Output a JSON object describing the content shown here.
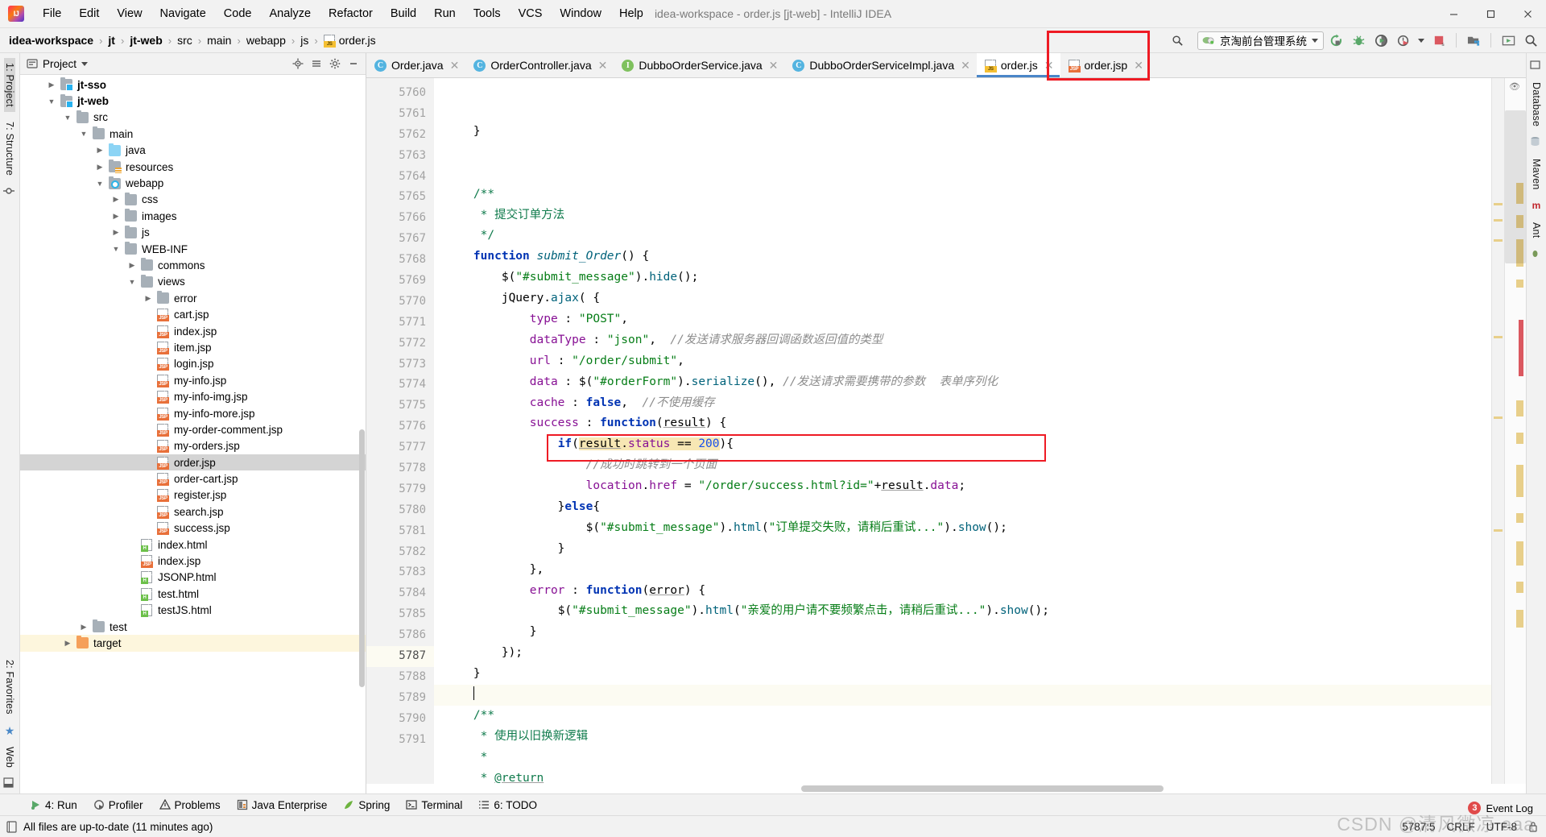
{
  "window": {
    "title": "idea-workspace - order.js [jt-web] - IntelliJ IDEA",
    "logo_name": "intellij-idea-logo",
    "minimize_label": "─",
    "maximize_label": "☐",
    "close_label": "✕"
  },
  "menubar": {
    "items": [
      {
        "label": "File"
      },
      {
        "label": "Edit"
      },
      {
        "label": "View"
      },
      {
        "label": "Navigate"
      },
      {
        "label": "Code"
      },
      {
        "label": "Analyze"
      },
      {
        "label": "Refactor"
      },
      {
        "label": "Build"
      },
      {
        "label": "Run"
      },
      {
        "label": "Tools"
      },
      {
        "label": "VCS"
      },
      {
        "label": "Window"
      },
      {
        "label": "Help"
      }
    ]
  },
  "navbar": {
    "breadcrumbs": [
      {
        "label": "idea-workspace",
        "bold": true
      },
      {
        "label": "jt",
        "bold": true
      },
      {
        "label": "jt-web",
        "bold": true
      },
      {
        "label": "src",
        "bold": false
      },
      {
        "label": "main",
        "bold": false
      },
      {
        "label": "webapp",
        "bold": false
      },
      {
        "label": "js",
        "bold": false
      },
      {
        "label": "order.js",
        "bold": false,
        "icon": "js-file-icon"
      }
    ],
    "separator": "›",
    "run_config": "京淘前台管理系统",
    "run_config_icon": "tomcat-icon",
    "actions": [
      {
        "name": "rerun-icon",
        "title": "Rerun"
      },
      {
        "name": "debug-icon",
        "title": "Debug"
      },
      {
        "name": "run-with-coverage-icon",
        "title": "Run with Coverage"
      },
      {
        "name": "profiler-icon",
        "title": "Profiler"
      },
      {
        "name": "stop-icon",
        "title": "Stop"
      },
      {
        "name": "project-structure-icon",
        "title": "Project Structure"
      },
      {
        "name": "updates-icon",
        "title": "Updates"
      },
      {
        "name": "search-everywhere-icon",
        "title": "Search Everywhere"
      }
    ]
  },
  "left_strip": {
    "items": [
      {
        "label": "1: Project",
        "name": "sidebar-item-project",
        "selected": true
      },
      {
        "label": "7: Structure",
        "name": "sidebar-item-structure",
        "selected": false
      }
    ],
    "bottom_items": [
      {
        "label": "2: Favorites",
        "name": "sidebar-item-favorites"
      },
      {
        "label": "Web",
        "name": "sidebar-item-web"
      }
    ]
  },
  "right_strip": {
    "items": [
      {
        "label": "Database",
        "name": "sidebar-item-database"
      },
      {
        "label": "Maven",
        "name": "sidebar-item-maven"
      },
      {
        "label": "Ant",
        "name": "sidebar-item-ant"
      }
    ]
  },
  "project_panel": {
    "title": "Project",
    "dropdown_caret": "▾",
    "actions": [
      {
        "name": "locate-icon",
        "title": "Select Opened File"
      },
      {
        "name": "collapse-all-icon",
        "title": "Collapse All"
      },
      {
        "name": "settings-gear-icon",
        "title": "Settings"
      },
      {
        "name": "hide-icon",
        "title": "Hide"
      }
    ],
    "tree": [
      {
        "indent": 1,
        "arrow": "right",
        "icon": "module",
        "label": "jt-sso",
        "bold": true
      },
      {
        "indent": 1,
        "arrow": "down",
        "icon": "module",
        "label": "jt-web",
        "bold": true
      },
      {
        "indent": 2,
        "arrow": "down",
        "icon": "folder",
        "label": "src",
        "bold": false
      },
      {
        "indent": 3,
        "arrow": "down",
        "icon": "folder",
        "label": "main",
        "bold": false
      },
      {
        "indent": 4,
        "arrow": "right",
        "icon": "folder-blue",
        "label": "java",
        "bold": false
      },
      {
        "indent": 4,
        "arrow": "right",
        "icon": "folder-res",
        "label": "resources",
        "bold": false
      },
      {
        "indent": 4,
        "arrow": "down",
        "icon": "folder-webapp",
        "label": "webapp",
        "bold": false
      },
      {
        "indent": 5,
        "arrow": "right",
        "icon": "folder",
        "label": "css",
        "bold": false
      },
      {
        "indent": 5,
        "arrow": "right",
        "icon": "folder",
        "label": "images",
        "bold": false
      },
      {
        "indent": 5,
        "arrow": "right",
        "icon": "folder",
        "label": "js",
        "bold": false
      },
      {
        "indent": 5,
        "arrow": "down",
        "icon": "folder",
        "label": "WEB-INF",
        "bold": false
      },
      {
        "indent": 6,
        "arrow": "right",
        "icon": "folder",
        "label": "commons",
        "bold": false
      },
      {
        "indent": 6,
        "arrow": "down",
        "icon": "folder",
        "label": "views",
        "bold": false
      },
      {
        "indent": 7,
        "arrow": "right",
        "icon": "folder",
        "label": "error",
        "bold": false
      },
      {
        "indent": 7,
        "arrow": "none",
        "icon": "jsp",
        "label": "cart.jsp",
        "bold": false
      },
      {
        "indent": 7,
        "arrow": "none",
        "icon": "jsp",
        "label": "index.jsp",
        "bold": false
      },
      {
        "indent": 7,
        "arrow": "none",
        "icon": "jsp",
        "label": "item.jsp",
        "bold": false
      },
      {
        "indent": 7,
        "arrow": "none",
        "icon": "jsp",
        "label": "login.jsp",
        "bold": false
      },
      {
        "indent": 7,
        "arrow": "none",
        "icon": "jsp",
        "label": "my-info.jsp",
        "bold": false
      },
      {
        "indent": 7,
        "arrow": "none",
        "icon": "jsp",
        "label": "my-info-img.jsp",
        "bold": false
      },
      {
        "indent": 7,
        "arrow": "none",
        "icon": "jsp",
        "label": "my-info-more.jsp",
        "bold": false
      },
      {
        "indent": 7,
        "arrow": "none",
        "icon": "jsp",
        "label": "my-order-comment.jsp",
        "bold": false
      },
      {
        "indent": 7,
        "arrow": "none",
        "icon": "jsp",
        "label": "my-orders.jsp",
        "bold": false
      },
      {
        "indent": 7,
        "arrow": "none",
        "icon": "jsp",
        "label": "order.jsp",
        "bold": false,
        "selected": true
      },
      {
        "indent": 7,
        "arrow": "none",
        "icon": "jsp",
        "label": "order-cart.jsp",
        "bold": false
      },
      {
        "indent": 7,
        "arrow": "none",
        "icon": "jsp",
        "label": "register.jsp",
        "bold": false
      },
      {
        "indent": 7,
        "arrow": "none",
        "icon": "jsp",
        "label": "search.jsp",
        "bold": false
      },
      {
        "indent": 7,
        "arrow": "none",
        "icon": "jsp",
        "label": "success.jsp",
        "bold": false
      },
      {
        "indent": 6,
        "arrow": "none",
        "icon": "html",
        "label": "index.html",
        "bold": false
      },
      {
        "indent": 6,
        "arrow": "none",
        "icon": "jsp",
        "label": "index.jsp",
        "bold": false
      },
      {
        "indent": 6,
        "arrow": "none",
        "icon": "html",
        "label": "JSONP.html",
        "bold": false
      },
      {
        "indent": 6,
        "arrow": "none",
        "icon": "html",
        "label": "test.html",
        "bold": false
      },
      {
        "indent": 6,
        "arrow": "none",
        "icon": "html",
        "label": "testJS.html",
        "bold": false
      },
      {
        "indent": 3,
        "arrow": "right",
        "icon": "folder",
        "label": "test",
        "bold": false
      },
      {
        "indent": 2,
        "arrow": "right",
        "icon": "folder-orange",
        "label": "target",
        "bold": false,
        "highlight": true
      }
    ]
  },
  "editor_tabs": [
    {
      "label": "Order.java",
      "icon": "class-icon",
      "icon_letter": "C",
      "icon_kind": "c",
      "active": false
    },
    {
      "label": "OrderController.java",
      "icon": "class-icon",
      "icon_letter": "C",
      "icon_kind": "c",
      "active": false
    },
    {
      "label": "DubboOrderService.java",
      "icon": "interface-icon",
      "icon_letter": "I",
      "icon_kind": "i",
      "active": false
    },
    {
      "label": "DubboOrderServiceImpl.java",
      "icon": "class-icon",
      "icon_letter": "C",
      "icon_kind": "c",
      "active": false
    },
    {
      "label": "order.js",
      "icon": "js-file-icon",
      "icon_kind": "js",
      "active": true
    },
    {
      "label": "order.jsp",
      "icon": "jsp-file-icon",
      "icon_kind": "jsp",
      "active": false
    }
  ],
  "editor": {
    "first_line": 5760,
    "current_line": 5787,
    "lines": [
      {
        "n": 5760,
        "fold": "end",
        "html": "    }"
      },
      {
        "n": 5761,
        "fold": "",
        "html": ""
      },
      {
        "n": 5762,
        "fold": "",
        "html": ""
      },
      {
        "n": 5763,
        "fold": "start",
        "html": "    <span class=\"jdoc\">/**</span>"
      },
      {
        "n": 5764,
        "fold": "",
        "html": "     <span class=\"jdoc\">* 提交订单方法</span>"
      },
      {
        "n": 5765,
        "fold": "end",
        "html": "     <span class=\"jdoc\">*/</span>"
      },
      {
        "n": 5766,
        "fold": "start",
        "html": "    <span class=\"kw\">function</span> <span class=\"fn\">submit_Order</span>() {"
      },
      {
        "n": 5767,
        "fold": "",
        "html": "        <span class=\"id\">$</span>(<span class=\"str\">\"#submit_message\"</span>).<span class=\"fnname\">hide</span>();"
      },
      {
        "n": 5768,
        "fold": "start",
        "html": "        <span class=\"id\">jQuery</span>.<span class=\"fnname\">ajax</span>( {"
      },
      {
        "n": 5769,
        "fold": "",
        "html": "            <span class=\"prop\">type</span> : <span class=\"str\">\"POST\"</span>,"
      },
      {
        "n": 5770,
        "fold": "",
        "html": "            <span class=\"prop\">dataType</span> : <span class=\"str\">\"json\"</span>,  <span class=\"com\">//发送请求服务器回调函数返回值的类型</span>"
      },
      {
        "n": 5771,
        "fold": "",
        "html": "            <span class=\"prop\">url</span> : <span class=\"str\">\"/order/submit\"</span>,"
      },
      {
        "n": 5772,
        "fold": "",
        "html": "            <span class=\"prop\">data</span> : <span class=\"id\">$</span>(<span class=\"str\">\"#orderForm\"</span>).<span class=\"fnname\">serialize</span>(), <span class=\"com\">//发送请求需要携带的参数  表单序列化</span>"
      },
      {
        "n": 5773,
        "fold": "",
        "html": "            <span class=\"prop\">cache</span> : <span class=\"kw\">false</span>,  <span class=\"com\">//不使用缓存</span>"
      },
      {
        "n": 5774,
        "fold": "start",
        "html": "            <span class=\"prop\">success</span> : <span class=\"kw\">function</span>(<span class=\"und\">result</span>) {"
      },
      {
        "n": 5775,
        "fold": "",
        "html": "                <span class=\"kw\">if</span>(<span class=\"hl\"><span class=\"und\">result</span>.<span class=\"prop\">status</span> == <span class=\"num\">200</span></span>){"
      },
      {
        "n": 5776,
        "fold": "",
        "html": "                    <span class=\"com\">//成功时跳转到一个页面</span>"
      },
      {
        "n": 5777,
        "fold": "",
        "html": "                    <span class=\"prop\">location</span>.<span class=\"prop\">href</span> = <span class=\"str\">\"/order/success.html?id=\"</span>+<span class=\"und\">result</span>.<span class=\"prop\">data</span>;"
      },
      {
        "n": 5778,
        "fold": "",
        "html": "                }<span class=\"kw\">else</span>{"
      },
      {
        "n": 5779,
        "fold": "",
        "html": "                    <span class=\"id\">$</span>(<span class=\"str\">\"#submit_message\"</span>).<span class=\"fnname\">html</span>(<span class=\"str\">\"订单提交失败，请稍后重试...\"</span>).<span class=\"fnname\">show</span>();"
      },
      {
        "n": 5780,
        "fold": "",
        "html": "                }"
      },
      {
        "n": 5781,
        "fold": "end",
        "html": "            },"
      },
      {
        "n": 5782,
        "fold": "start",
        "html": "            <span class=\"prop\">error</span> : <span class=\"kw\">function</span>(<span class=\"und\">error</span>) {"
      },
      {
        "n": 5783,
        "fold": "",
        "html": "                <span class=\"id\">$</span>(<span class=\"str\">\"#submit_message\"</span>).<span class=\"fnname\">html</span>(<span class=\"str\">\"亲爱的用户请不要频繁点击，请稍后重试...\"</span>).<span class=\"fnname\">show</span>();"
      },
      {
        "n": 5784,
        "fold": "end",
        "html": "            }"
      },
      {
        "n": 5785,
        "fold": "end",
        "html": "        });"
      },
      {
        "n": 5786,
        "fold": "end",
        "html": "    }"
      },
      {
        "n": 5787,
        "fold": "",
        "html": "    <span class=\"caretbar\"></span>",
        "current": true
      },
      {
        "n": 5788,
        "fold": "start",
        "html": "    <span class=\"jdoc\">/**</span>"
      },
      {
        "n": 5789,
        "fold": "",
        "html": "     <span class=\"jdoc\">* 使用以旧换新逻辑</span>"
      },
      {
        "n": 5790,
        "fold": "",
        "html": "     <span class=\"jdoc\">*</span>"
      },
      {
        "n": 5791,
        "fold": "",
        "html": "     <span class=\"jdoc\">* </span><span class=\"jdoc und\">@return</span>"
      }
    ],
    "annotation_box_line": 5777
  },
  "bottom_toolwindows": [
    {
      "label": "4: Run",
      "mnemonic": "4",
      "name": "tool-window-run",
      "icon": "run-icon"
    },
    {
      "label": "Profiler",
      "name": "tool-window-profiler",
      "icon": "profiler-icon"
    },
    {
      "label": "Problems",
      "name": "tool-window-problems",
      "icon": "warning-icon"
    },
    {
      "label": "Java Enterprise",
      "name": "tool-window-java-enterprise",
      "icon": "java-enterprise-icon"
    },
    {
      "label": "Spring",
      "name": "tool-window-spring",
      "icon": "spring-leaf-icon"
    },
    {
      "label": "Terminal",
      "name": "tool-window-terminal",
      "icon": "terminal-icon"
    },
    {
      "label": "6: TODO",
      "mnemonic": "6",
      "name": "tool-window-todo",
      "icon": "todo-list-icon"
    }
  ],
  "statusbar": {
    "message": "All files are up-to-date (11 minutes ago)",
    "message_icon": "document-icon",
    "event_log": "Event Log",
    "event_count": "3",
    "caret_position": "5787:5",
    "line_separator": "CRLF",
    "encoding": "UTF-8",
    "watermark": "CSDN @清风微凉 aaa"
  }
}
